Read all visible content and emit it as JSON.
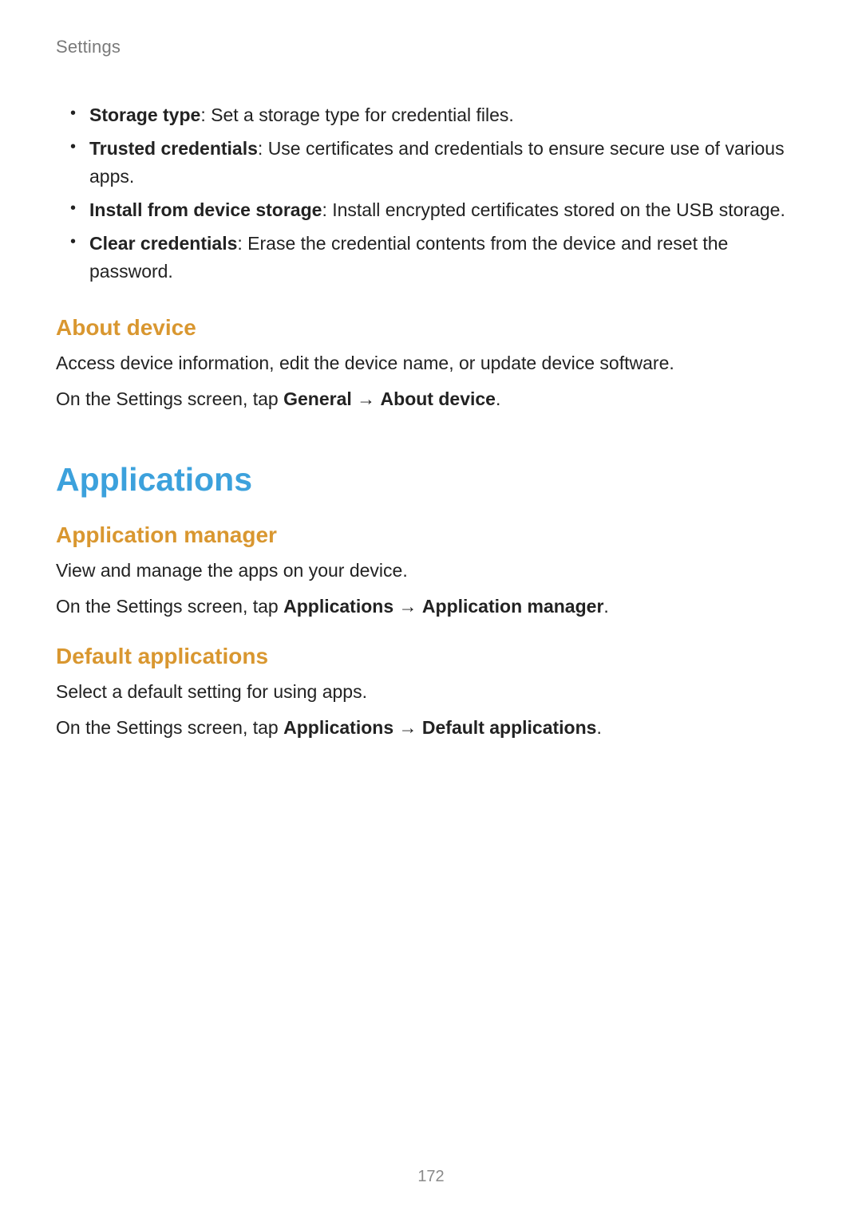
{
  "header": "Settings",
  "bullets": [
    {
      "label": "Storage type",
      "desc": ": Set a storage type for credential files."
    },
    {
      "label": "Trusted credentials",
      "desc": ": Use certificates and credentials to ensure secure use of various apps."
    },
    {
      "label": "Install from device storage",
      "desc": ": Install encrypted certificates stored on the USB storage."
    },
    {
      "label": "Clear credentials",
      "desc": ": Erase the credential contents from the device and reset the password."
    }
  ],
  "about": {
    "heading": "About device",
    "p1": "Access device information, edit the device name, or update device software.",
    "p2_pre": "On the Settings screen, tap ",
    "p2_b1": "General",
    "p2_arrow": " → ",
    "p2_b2": "About device",
    "p2_post": "."
  },
  "applications": {
    "heading": "Applications",
    "app_mgr": {
      "heading": "Application manager",
      "p1": "View and manage the apps on your device.",
      "p2_pre": "On the Settings screen, tap ",
      "p2_b1": "Applications",
      "p2_arrow": " → ",
      "p2_b2": "Application manager",
      "p2_post": "."
    },
    "default_apps": {
      "heading": "Default applications",
      "p1": "Select a default setting for using apps.",
      "p2_pre": "On the Settings screen, tap ",
      "p2_b1": "Applications",
      "p2_arrow": " → ",
      "p2_b2": "Default applications",
      "p2_post": "."
    }
  },
  "page_number": "172"
}
